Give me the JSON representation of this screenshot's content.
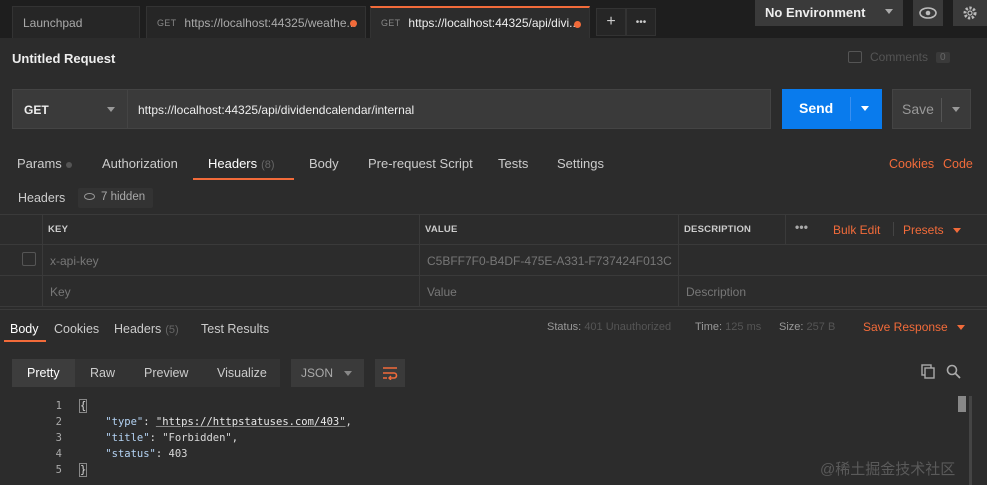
{
  "tabs": [
    {
      "method": "",
      "label": "Launchpad",
      "active": false,
      "modified": false
    },
    {
      "method": "GET",
      "label": "https://localhost:44325/weathe...",
      "active": false,
      "modified": true
    },
    {
      "method": "GET",
      "label": "https://localhost:44325/api/divi...",
      "active": true,
      "modified": true
    }
  ],
  "tab_actions": {
    "add": "+",
    "more": "•••"
  },
  "environment": {
    "selected": "No Environment"
  },
  "request": {
    "title": "Untitled Request",
    "comments_label": "Comments",
    "comments_count": "0",
    "method": "GET",
    "url": "https://localhost:44325/api/dividendcalendar/internal",
    "send_label": "Send",
    "save_label": "Save"
  },
  "request_tabs": [
    {
      "label": "Params",
      "badge": ""
    },
    {
      "label": "Authorization",
      "badge": ""
    },
    {
      "label": "Headers",
      "badge": "(8)"
    },
    {
      "label": "Body",
      "badge": ""
    },
    {
      "label": "Pre-request Script",
      "badge": ""
    },
    {
      "label": "Tests",
      "badge": ""
    },
    {
      "label": "Settings",
      "badge": ""
    }
  ],
  "request_links": {
    "cookies": "Cookies",
    "code": "Code"
  },
  "headers_section": {
    "label": "Headers",
    "hidden": "7 hidden"
  },
  "table": {
    "columns": [
      "KEY",
      "VALUE",
      "DESCRIPTION"
    ],
    "actions": {
      "more": "•••",
      "bulk_edit": "Bulk Edit",
      "presets": "Presets"
    },
    "rows": [
      {
        "key": "x-api-key",
        "value": "C5BFF7F0-B4DF-475E-A331-F737424F013C",
        "description": ""
      }
    ],
    "placeholder": {
      "key": "Key",
      "value": "Value",
      "description": "Description"
    }
  },
  "response_tabs": [
    {
      "label": "Body",
      "badge": ""
    },
    {
      "label": "Cookies",
      "badge": ""
    },
    {
      "label": "Headers",
      "badge": "(5)"
    },
    {
      "label": "Test Results",
      "badge": ""
    }
  ],
  "response_status": {
    "status_label": "Status:",
    "status": "401 Unauthorized",
    "time_label": "Time:",
    "time": "125 ms",
    "size_label": "Size:",
    "size": "257 B",
    "save_response": "Save Response"
  },
  "view_modes": [
    "Pretty",
    "Raw",
    "Preview",
    "Visualize"
  ],
  "format": "JSON",
  "response_body": {
    "line_numbers": [
      "1",
      "2",
      "3",
      "4",
      "5"
    ],
    "type_key": "\"type\"",
    "type_value": "\"https://httpstatuses.com/403\"",
    "title_key": "\"title\"",
    "title_value": "\"Forbidden\"",
    "status_key": "\"status\"",
    "status_value": "403"
  },
  "watermark": "@稀土掘金技术社区",
  "colors": {
    "accent": "#f26b3a",
    "send": "#097bed",
    "background": "#2c2c2c"
  }
}
